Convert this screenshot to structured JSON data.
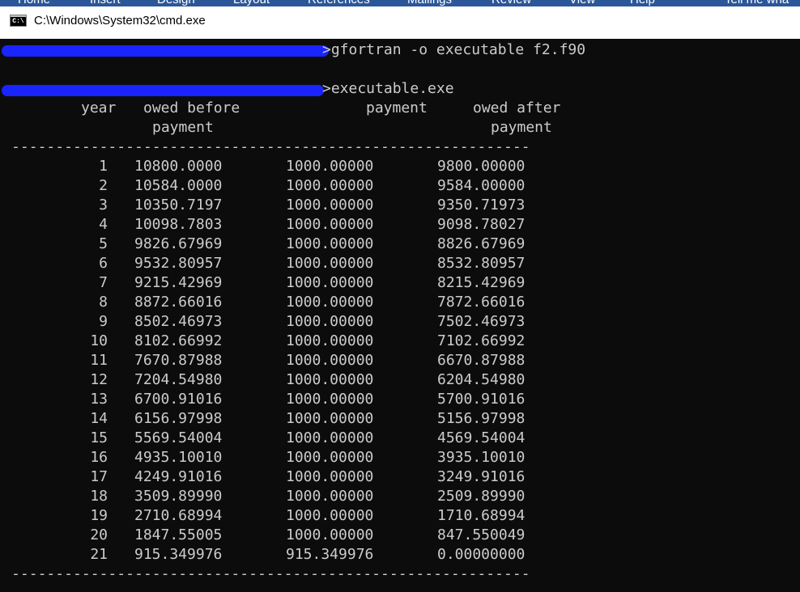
{
  "background_app": {
    "ribbon_tabs": [
      "Home",
      "Insert",
      "Design",
      "Layout",
      "References",
      "Mailings",
      "Review",
      "View",
      "Help",
      "Tell me wha"
    ]
  },
  "window": {
    "title": "C:\\Windows\\System32\\cmd.exe",
    "icon_label": "C:\\"
  },
  "console": {
    "commands": [
      {
        "text": ">gfortran -o executable f2.f90"
      },
      {
        "text": ">executable.exe"
      }
    ],
    "table": {
      "headers": {
        "year": "year",
        "owed_before_1": "owed before",
        "owed_before_2": "payment",
        "payment": "payment",
        "owed_after_1": "owed after",
        "owed_after_2": "payment"
      },
      "rule": "-----------------------------------------------------------",
      "rows": [
        {
          "year": "1",
          "owed_before": "10800.0000",
          "payment": "1000.00000",
          "owed_after": "9800.00000"
        },
        {
          "year": "2",
          "owed_before": "10584.0000",
          "payment": "1000.00000",
          "owed_after": "9584.00000"
        },
        {
          "year": "3",
          "owed_before": "10350.7197",
          "payment": "1000.00000",
          "owed_after": "9350.71973"
        },
        {
          "year": "4",
          "owed_before": "10098.7803",
          "payment": "1000.00000",
          "owed_after": "9098.78027"
        },
        {
          "year": "5",
          "owed_before": "9826.67969",
          "payment": "1000.00000",
          "owed_after": "8826.67969"
        },
        {
          "year": "6",
          "owed_before": "9532.80957",
          "payment": "1000.00000",
          "owed_after": "8532.80957"
        },
        {
          "year": "7",
          "owed_before": "9215.42969",
          "payment": "1000.00000",
          "owed_after": "8215.42969"
        },
        {
          "year": "8",
          "owed_before": "8872.66016",
          "payment": "1000.00000",
          "owed_after": "7872.66016"
        },
        {
          "year": "9",
          "owed_before": "8502.46973",
          "payment": "1000.00000",
          "owed_after": "7502.46973"
        },
        {
          "year": "10",
          "owed_before": "8102.66992",
          "payment": "1000.00000",
          "owed_after": "7102.66992"
        },
        {
          "year": "11",
          "owed_before": "7670.87988",
          "payment": "1000.00000",
          "owed_after": "6670.87988"
        },
        {
          "year": "12",
          "owed_before": "7204.54980",
          "payment": "1000.00000",
          "owed_after": "6204.54980"
        },
        {
          "year": "13",
          "owed_before": "6700.91016",
          "payment": "1000.00000",
          "owed_after": "5700.91016"
        },
        {
          "year": "14",
          "owed_before": "6156.97998",
          "payment": "1000.00000",
          "owed_after": "5156.97998"
        },
        {
          "year": "15",
          "owed_before": "5569.54004",
          "payment": "1000.00000",
          "owed_after": "4569.54004"
        },
        {
          "year": "16",
          "owed_before": "4935.10010",
          "payment": "1000.00000",
          "owed_after": "3935.10010"
        },
        {
          "year": "17",
          "owed_before": "4249.91016",
          "payment": "1000.00000",
          "owed_after": "3249.91016"
        },
        {
          "year": "18",
          "owed_before": "3509.89990",
          "payment": "1000.00000",
          "owed_after": "2509.89990"
        },
        {
          "year": "19",
          "owed_before": "2710.68994",
          "payment": "1000.00000",
          "owed_after": "1710.68994"
        },
        {
          "year": "20",
          "owed_before": "1847.55005",
          "payment": "1000.00000",
          "owed_after": "847.550049"
        },
        {
          "year": "21",
          "owed_before": "915.349976",
          "payment": "915.349976",
          "owed_after": "0.00000000"
        }
      ]
    }
  },
  "colors": {
    "console_background": "#0c0c0c",
    "console_text": "#cccccc",
    "redaction_marker": "#1a24ff",
    "titlebar": "#ffffff",
    "ribbon": "#2b579a"
  }
}
